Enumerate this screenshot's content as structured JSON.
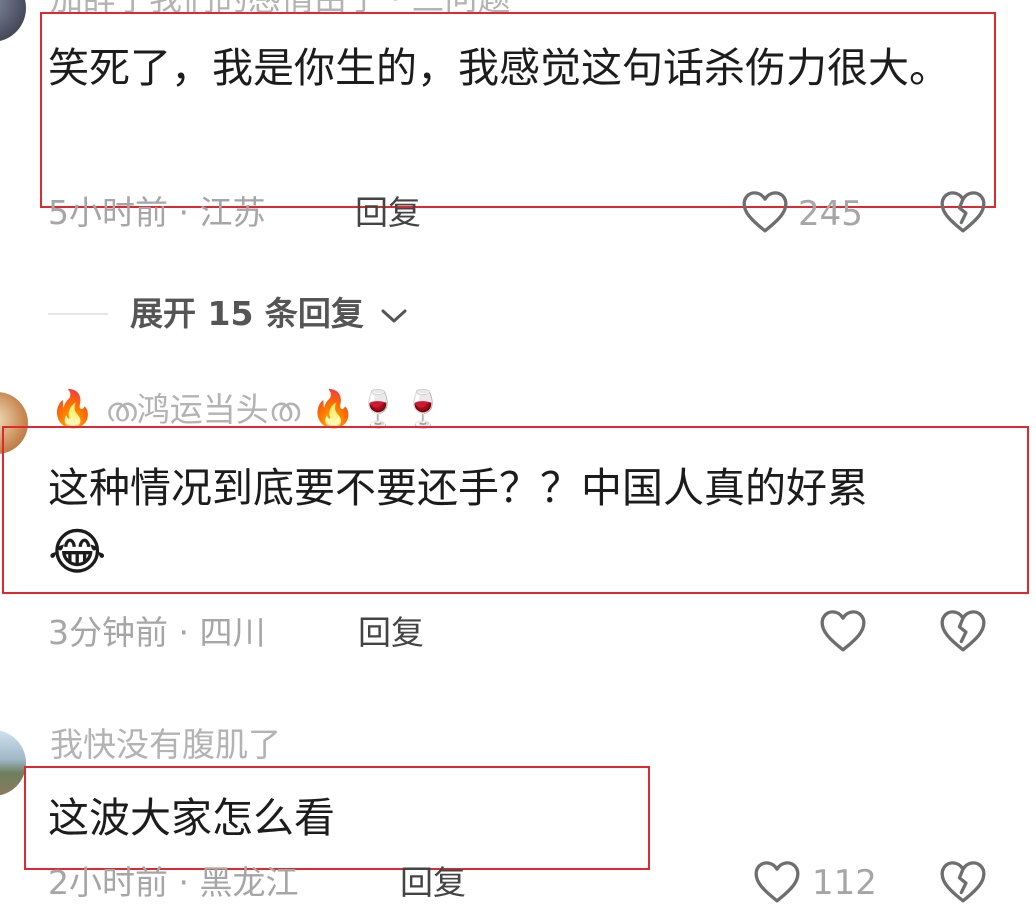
{
  "comments": [
    {
      "username": "加辞了我们的感情由于 · 三问题",
      "text": "笑死了，我是你生的，我感觉这句话杀伤力很大。",
      "time_location": "5小时前 · 江苏",
      "reply_label": "回复",
      "likes": "245"
    },
    {
      "username_prefix_emoji": "🔥",
      "username": "ത鸿运当头ത",
      "username_suffix_emoji": "🔥🍷🍷",
      "text": "这种情况到底要不要还手？？中国人真的好累",
      "text_emoji": "😂",
      "time_location": "3分钟前 · 四川",
      "reply_label": "回复"
    },
    {
      "username": "我快没有腹肌了",
      "text": "这波大家怎么看",
      "time_location": "2小时前 · 黑龙江",
      "reply_label": "回复",
      "likes": "112"
    }
  ],
  "expand_replies": {
    "label": "展开 15 条回复"
  },
  "icons": {
    "like": "heart-outline-icon",
    "dislike": "broken-heart-icon",
    "chevron": "chevron-down-icon"
  },
  "colors": {
    "highlight_box": "#e0282e",
    "text": "#1c1c1c",
    "meta": "#a6a6a6"
  }
}
